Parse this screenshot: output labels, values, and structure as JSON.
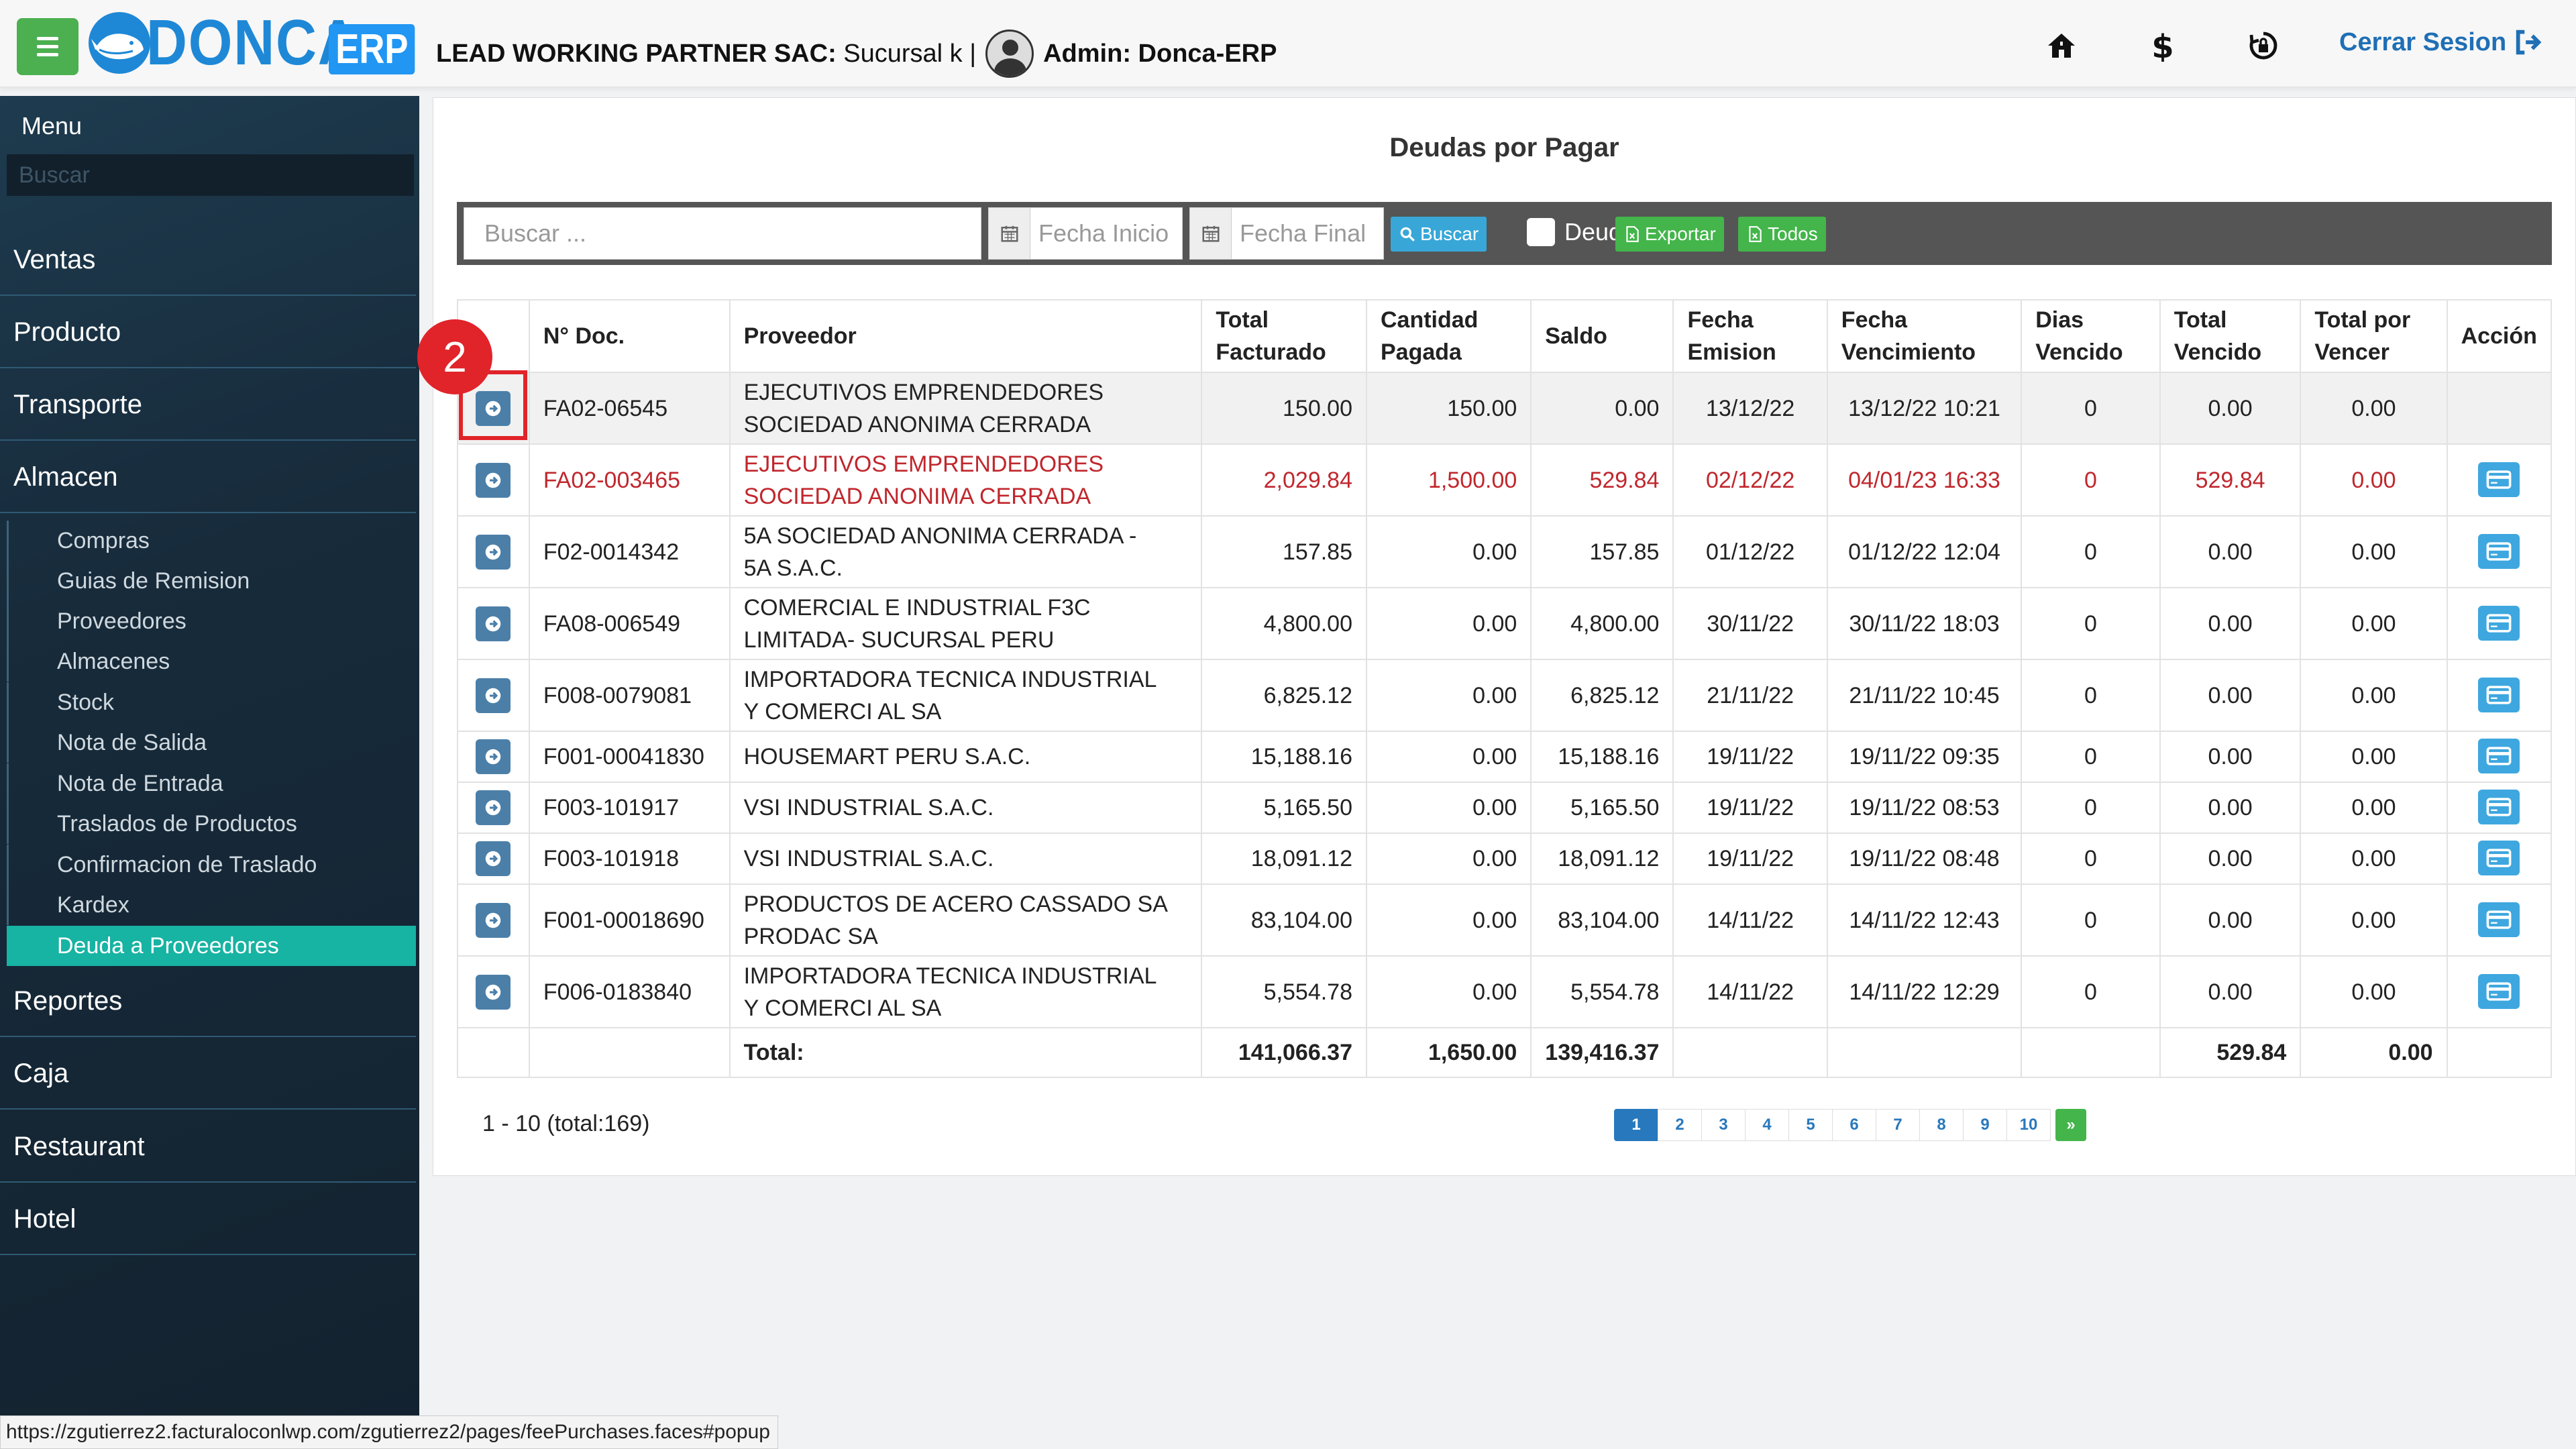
{
  "header": {
    "brand": "DONCA",
    "brand_tag": "ERP",
    "company": "LEAD WORKING PARTNER SAC:",
    "branch": " Sucursal k |",
    "admin": "Admin: Donca-ERP",
    "logout_label": "Cerrar Sesion",
    "icons": [
      "home-icon",
      "dollar-icon",
      "lock-rotate-icon",
      "logout-icon"
    ]
  },
  "sidebar": {
    "title": "Menu",
    "search_placeholder": "Buscar",
    "items": [
      "Ventas",
      "Producto",
      "Transporte",
      "Almacen",
      "Reportes",
      "Caja",
      "Restaurant",
      "Hotel"
    ],
    "almacen_sub": [
      "Compras",
      "Guias de Remision",
      "Proveedores",
      "Almacenes",
      "Stock",
      "Nota de Salida",
      "Nota de Entrada",
      "Traslados de Productos",
      "Confirmacion de Traslado",
      "Kardex",
      "Deuda a Proveedores"
    ],
    "active_sub": "Deuda a Proveedores"
  },
  "main": {
    "title": "Deudas por Pagar",
    "toolbar": {
      "search_placeholder": "Buscar ...",
      "date_start_placeholder": "Fecha Inicio",
      "date_end_placeholder": "Fecha Final",
      "search_btn": "Buscar",
      "deuda_label": "Deuda",
      "export_btn": "Exportar",
      "all_btn": "Todos"
    },
    "columns": [
      "",
      "N° Doc.",
      "Proveedor",
      "Total Facturado",
      "Cantidad Pagada",
      "Saldo",
      "Fecha Emision",
      "Fecha Vencimiento",
      "Dias Vencido",
      "Total Vencido",
      "Total por Vencer",
      "Acción"
    ],
    "rows": [
      {
        "doc": "FA02-06545",
        "prov1": "EJECUTIVOS EMPRENDEDORES",
        "prov2": "SOCIEDAD ANONIMA CERRADA",
        "total": "150.00",
        "pagada": "150.00",
        "saldo": "0.00",
        "emision": "13/12/22",
        "venc": "13/12/22 10:21",
        "dias": "0",
        "vencido": "0.00",
        "porvencer": "0.00"
      },
      {
        "doc": "FA02-003465",
        "prov1": "EJECUTIVOS EMPRENDEDORES",
        "prov2": "SOCIEDAD ANONIMA CERRADA",
        "total": "2,029.84",
        "pagada": "1,500.00",
        "saldo": "529.84",
        "emision": "02/12/22",
        "venc": "04/01/23 16:33",
        "dias": "0",
        "vencido": "529.84",
        "porvencer": "0.00"
      },
      {
        "doc": "F02-0014342",
        "prov1": "5A SOCIEDAD ANONIMA CERRADA -",
        "prov2": "5A S.A.C.",
        "total": "157.85",
        "pagada": "0.00",
        "saldo": "157.85",
        "emision": "01/12/22",
        "venc": "01/12/22 12:04",
        "dias": "0",
        "vencido": "0.00",
        "porvencer": "0.00"
      },
      {
        "doc": "FA08-006549",
        "prov1": "COMERCIAL E INDUSTRIAL F3C",
        "prov2": "LIMITADA- SUCURSAL PERU",
        "total": "4,800.00",
        "pagada": "0.00",
        "saldo": "4,800.00",
        "emision": "30/11/22",
        "venc": "30/11/22 18:03",
        "dias": "0",
        "vencido": "0.00",
        "porvencer": "0.00"
      },
      {
        "doc": "F008-0079081",
        "prov1": "IMPORTADORA TECNICA INDUSTRIAL",
        "prov2": "Y COMERCI AL SA",
        "total": "6,825.12",
        "pagada": "0.00",
        "saldo": "6,825.12",
        "emision": "21/11/22",
        "venc": "21/11/22 10:45",
        "dias": "0",
        "vencido": "0.00",
        "porvencer": "0.00"
      },
      {
        "doc": "F001-00041830",
        "prov1": "HOUSEMART PERU S.A.C.",
        "prov2": "",
        "total": "15,188.16",
        "pagada": "0.00",
        "saldo": "15,188.16",
        "emision": "19/11/22",
        "venc": "19/11/22 09:35",
        "dias": "0",
        "vencido": "0.00",
        "porvencer": "0.00"
      },
      {
        "doc": "F003-101917",
        "prov1": "VSI INDUSTRIAL S.A.C.",
        "prov2": "",
        "total": "5,165.50",
        "pagada": "0.00",
        "saldo": "5,165.50",
        "emision": "19/11/22",
        "venc": "19/11/22 08:53",
        "dias": "0",
        "vencido": "0.00",
        "porvencer": "0.00"
      },
      {
        "doc": "F003-101918",
        "prov1": "VSI INDUSTRIAL S.A.C.",
        "prov2": "",
        "total": "18,091.12",
        "pagada": "0.00",
        "saldo": "18,091.12",
        "emision": "19/11/22",
        "venc": "19/11/22 08:48",
        "dias": "0",
        "vencido": "0.00",
        "porvencer": "0.00"
      },
      {
        "doc": "F001-00018690",
        "prov1": "PRODUCTOS DE ACERO CASSADO SA",
        "prov2": "PRODAC SA",
        "total": "83,104.00",
        "pagada": "0.00",
        "saldo": "83,104.00",
        "emision": "14/11/22",
        "venc": "14/11/22 12:43",
        "dias": "0",
        "vencido": "0.00",
        "porvencer": "0.00"
      },
      {
        "doc": "F006-0183840",
        "prov1": "IMPORTADORA TECNICA INDUSTRIAL",
        "prov2": "Y COMERCI AL SA",
        "total": "5,554.78",
        "pagada": "0.00",
        "saldo": "5,554.78",
        "emision": "14/11/22",
        "venc": "14/11/22 12:29",
        "dias": "0",
        "vencido": "0.00",
        "porvencer": "0.00"
      }
    ],
    "totals": {
      "label": "Total:",
      "total": "141,066.37",
      "pagada": "1,650.00",
      "saldo": "139,416.37",
      "vencido": "529.84",
      "porvencer": "0.00"
    },
    "range": "1 - 10 (total:169)",
    "pages": [
      "1",
      "2",
      "3",
      "4",
      "5",
      "6",
      "7",
      "8",
      "9",
      "10"
    ],
    "next": "»"
  },
  "annotation": {
    "step": "2"
  },
  "status_url": "https://zgutierrez2.facturaloconlwp.com/zgutierrez2/pages/feePurchases.faces#popup",
  "colors": {
    "accent": "#17b3a3",
    "primary": "#2878bd",
    "danger": "#c0272d",
    "green": "#43b54a"
  }
}
